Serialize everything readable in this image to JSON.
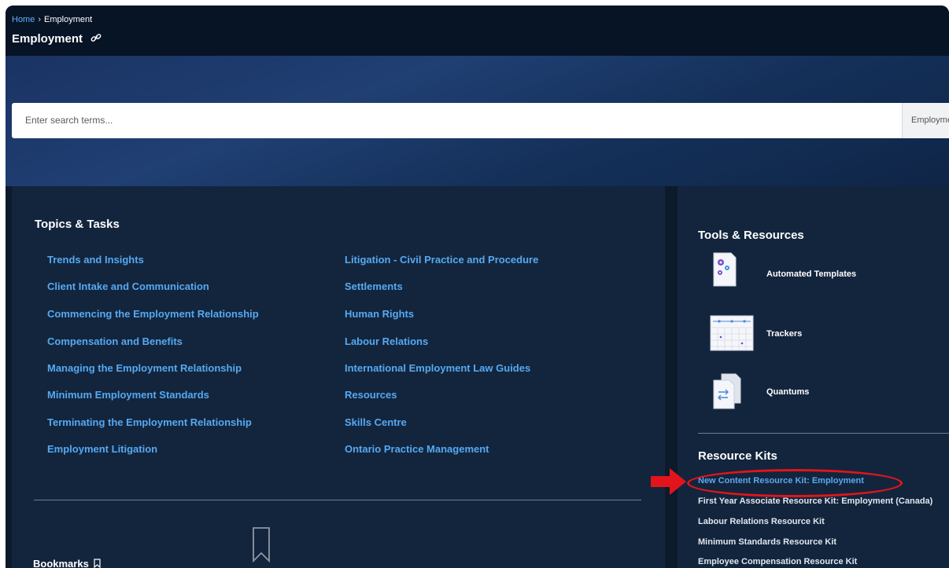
{
  "breadcrumb": {
    "home": "Home",
    "separator": "›",
    "current": "Employment"
  },
  "page": {
    "title": "Employment",
    "title_icon": "link-icon"
  },
  "search": {
    "placeholder": "Enter search terms...",
    "scope": "Employme"
  },
  "topics": {
    "heading": "Topics & Tasks",
    "left_column": [
      "Trends and Insights",
      "Client Intake and Communication",
      "Commencing the Employment Relationship",
      "Compensation and Benefits",
      "Managing the Employment Relationship",
      "Minimum Employment Standards",
      "Terminating the Employment Relationship",
      "Employment Litigation"
    ],
    "right_column": [
      "Litigation - Civil Practice and Procedure",
      "Settlements",
      "Human Rights",
      "Labour Relations",
      "International Employment Law Guides",
      "Resources",
      "Skills Centre",
      "Ontario Practice Management"
    ]
  },
  "bookmarks": {
    "heading": "Bookmarks",
    "icon": "bookmark-icon"
  },
  "tools": {
    "heading": "Tools & Resources",
    "items": [
      {
        "label": "Automated Templates",
        "icon": "automated-templates-icon"
      },
      {
        "label": "Trackers",
        "icon": "trackers-icon"
      },
      {
        "label": "Quantums",
        "icon": "quantums-icon"
      }
    ]
  },
  "resource_kits": {
    "heading": "Resource Kits",
    "items": [
      "New Content Resource Kit: Employment",
      "First Year Associate Resource Kit: Employment (Canada)",
      "Labour Relations Resource Kit",
      "Minimum Standards Resource Kit",
      "Employee Compensation Resource Kit"
    ]
  },
  "colors": {
    "link": "#55a9f2",
    "panel": "#13253d",
    "annotation": "#e1151b"
  }
}
